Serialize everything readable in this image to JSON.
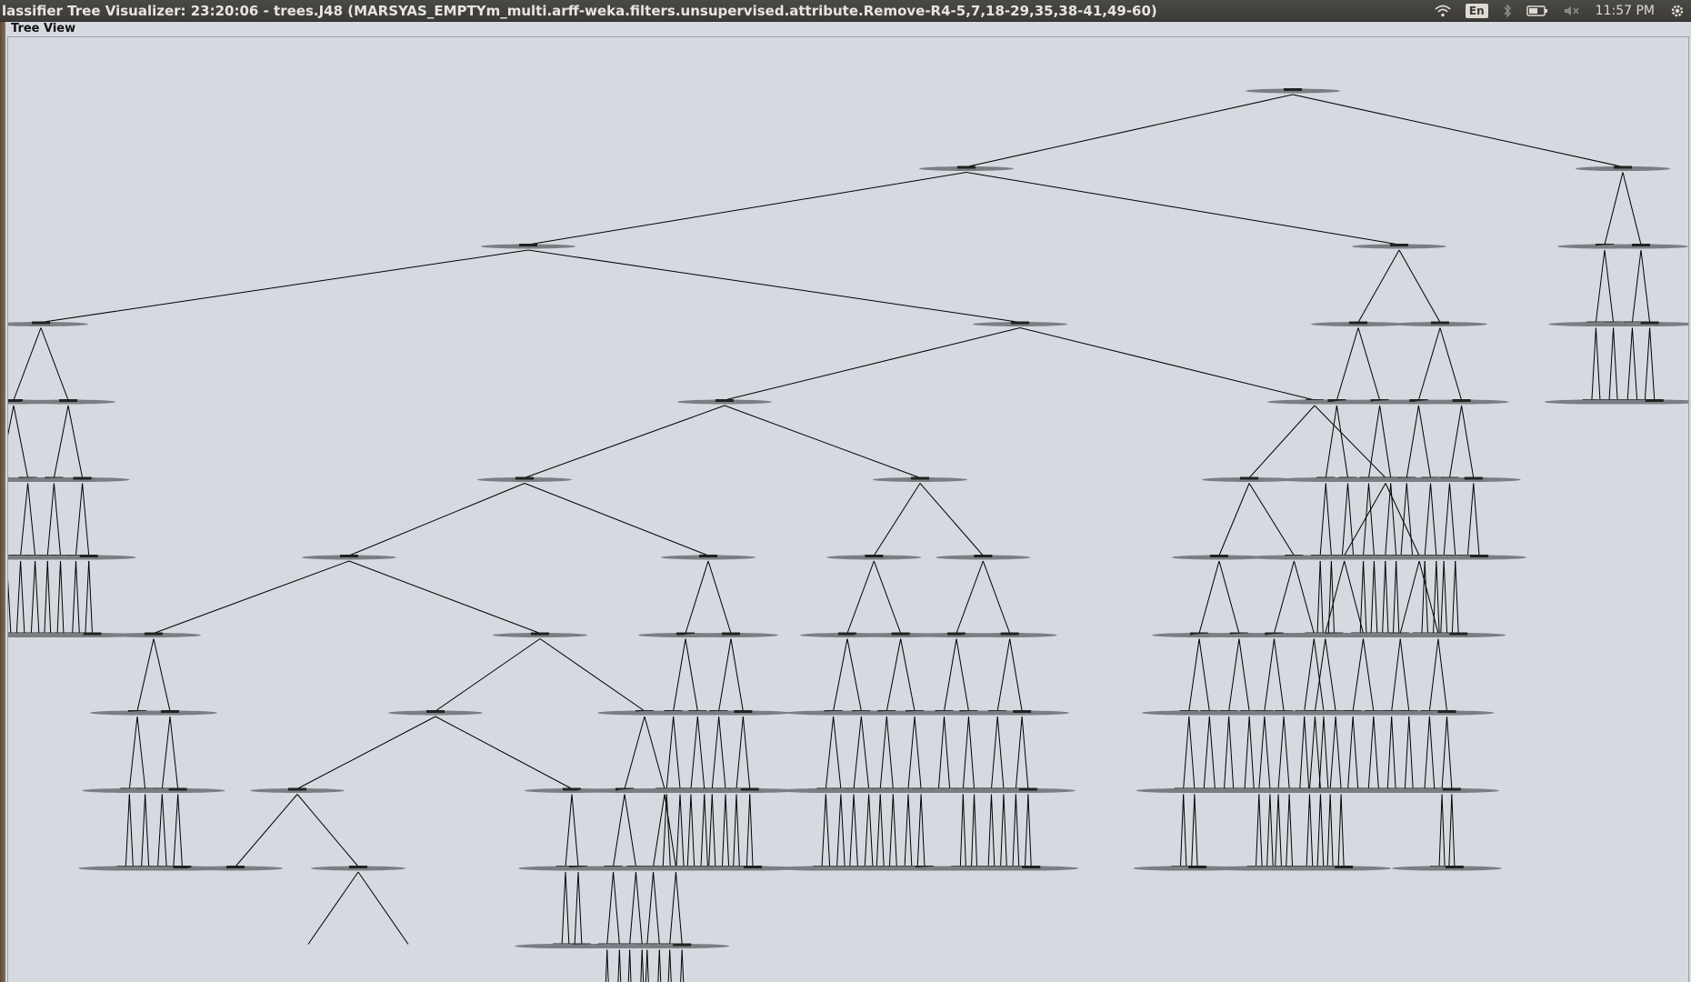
{
  "window": {
    "title": "lassifier Tree Visualizer: 23:20:06 - trees.J48 (MARSYAS_EMPTYm_multi.arff-weka.filters.unsupervised.attribute.Remove-R4-5,7,18-29,35,38-41,49-60)"
  },
  "system_tray": {
    "icons": [
      "wifi-icon",
      "keyboard-layout-indicator",
      "bluetooth-icon",
      "battery-icon",
      "volume-muted-icon",
      "settings-gear-icon"
    ],
    "keyboard_layout": "En",
    "clock": "11:57 PM"
  },
  "panel": {
    "label": "Tree View"
  },
  "tree": {
    "algorithm": "trees.J48",
    "colors": {
      "edge": "#000000",
      "node": "#7a7d82",
      "background": "#d6d9df"
    }
  }
}
